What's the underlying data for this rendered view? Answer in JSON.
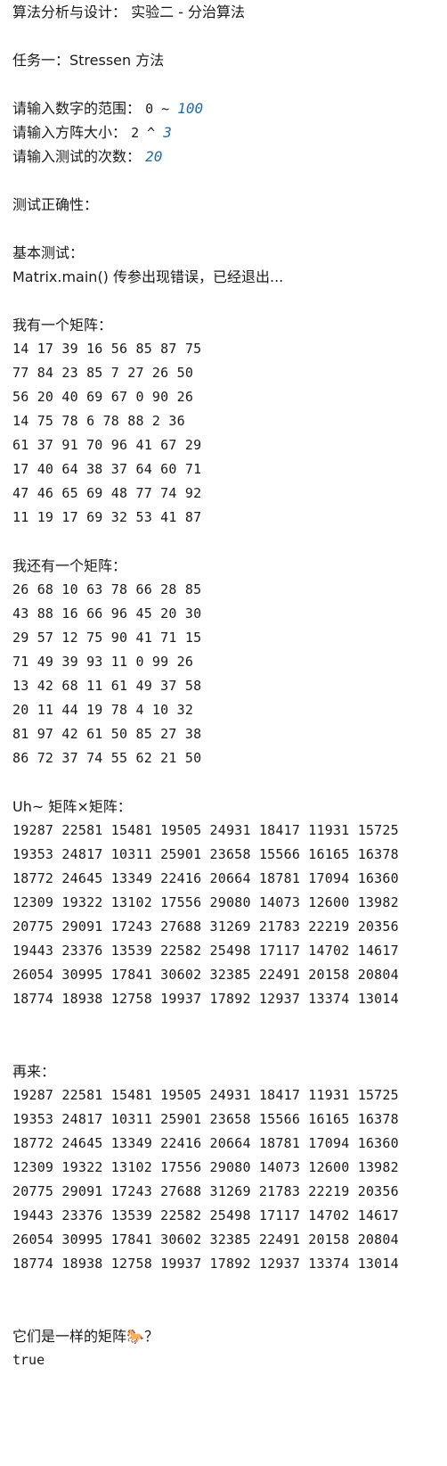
{
  "header": {
    "course_title": "算法分析与设计：",
    "experiment": "实验二 - 分治算法"
  },
  "task": {
    "title": "任务一：Stressen 方法"
  },
  "inputs": {
    "range_prompt": "请输入数字的范围：",
    "range_prefix": "0 ~ ",
    "range_value": "100",
    "size_prompt": "请输入方阵大小：",
    "size_prefix": "2 ^ ",
    "size_value": "3",
    "count_prompt": "请输入测试的次数：",
    "count_value": "20"
  },
  "correctness": {
    "heading": "测试正确性："
  },
  "basic_test": {
    "heading": "基本测试：",
    "message": "Matrix.main() 传参出现错误，已经退出..."
  },
  "matrix_a": {
    "label": "我有一个矩阵：",
    "rows": [
      "14 17 39 16 56 85 87 75",
      "77 84 23 85 7 27 26 50",
      "56 20 40 69 67 0 90 26",
      "14 75 78 6 78 88 2 36",
      "61 37 91 70 96 41 67 29",
      "17 40 64 38 37 64 60 71",
      "47 46 65 69 48 77 74 92",
      "11 19 17 69 32 53 41 87"
    ]
  },
  "matrix_b": {
    "label": "我还有一个矩阵：",
    "rows": [
      "26 68 10 63 78 66 28 85",
      "43 88 16 66 96 45 20 30",
      "29 57 12 75 90 41 71 15",
      "71 49 39 93 11 0 99 26",
      "13 42 68 11 61 49 37 58",
      "20 11 44 19 78 4 10 32",
      "81 97 42 61 50 85 27 38",
      "86 72 37 74 55 62 21 50"
    ]
  },
  "product": {
    "label": "Uh~ 矩阵×矩阵：",
    "rows": [
      "19287 22581 15481 19505 24931 18417 11931 15725",
      "19353 24817 10311 25901 23658 15566 16165 16378",
      "18772 24645 13349 22416 20664 18781 17094 16360",
      "12309 19322 13102 17556 29080 14073 12600 13982",
      "20775 29091 17243 27688 31269 21783 22219 20356",
      "19443 23376 13539 22582 25498 17117 14702 14617",
      "26054 30995 17841 30602 32385 22491 20158 20804",
      "18774 18938 12758 19937 17892 12937 13374 13014"
    ]
  },
  "again": {
    "label": "再来：",
    "rows": [
      "19287 22581 15481 19505 24931 18417 11931 15725",
      "19353 24817 10311 25901 23658 15566 16165 16378",
      "18772 24645 13349 22416 20664 18781 17094 16360",
      "12309 19322 13102 17556 29080 14073 12600 13982",
      "20775 29091 17243 27688 31269 21783 22219 20356",
      "19443 23376 13539 22582 25498 17117 14702 14617",
      "26054 30995 17841 30602 32385 22491 20158 20804",
      "18774 18938 12758 19937 17892 12937 13374 13014"
    ]
  },
  "conclusion": {
    "question_prefix": "它们是一样的矩阵",
    "horse_glyph": "🐎",
    "question_suffix": "？",
    "answer": "true"
  }
}
